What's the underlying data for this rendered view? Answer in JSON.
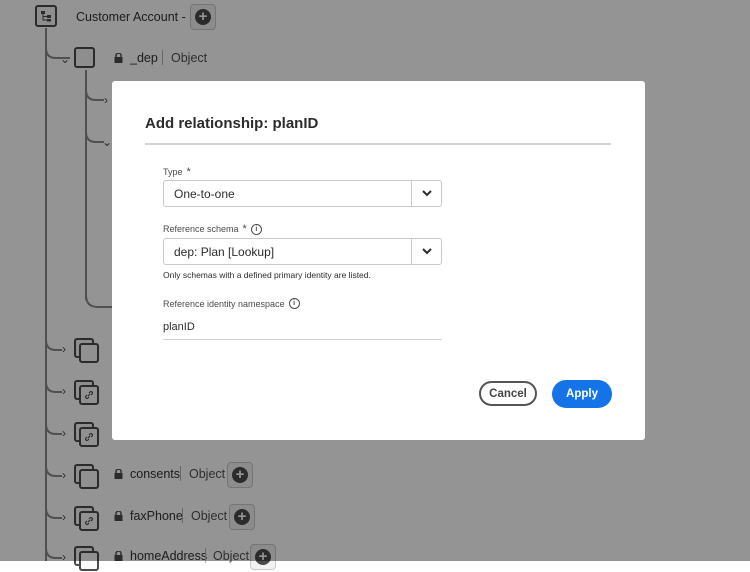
{
  "tree": {
    "root": {
      "label": "Customer Account - EK"
    },
    "dep": {
      "name": "_dep",
      "type": "Object"
    },
    "consents": {
      "name": "consents",
      "type": "Object"
    },
    "faxPhone": {
      "name": "faxPhone",
      "type": "Object"
    },
    "homeAddress": {
      "name": "homeAddress",
      "type": "Object"
    }
  },
  "dialog": {
    "title": "Add relationship: planID",
    "type_field": {
      "label": "Type",
      "required_mark": "*",
      "value": "One-to-one"
    },
    "schema_field": {
      "label": "Reference schema",
      "required_mark": "*",
      "value": "dep: Plan [Lookup]",
      "help": "Only schemas with a defined primary identity are listed."
    },
    "namespace_field": {
      "label": "Reference identity namespace",
      "value": "planID"
    },
    "cancel_label": "Cancel",
    "apply_label": "Apply"
  },
  "colors": {
    "accent": "#1473e6",
    "overlay": "rgba(0,0,0,0.42)"
  },
  "icons": [
    "schema-tree-icon",
    "add-icon",
    "lock-icon",
    "chevron-right-icon",
    "chevron-down-icon",
    "info-icon",
    "link-icon"
  ]
}
